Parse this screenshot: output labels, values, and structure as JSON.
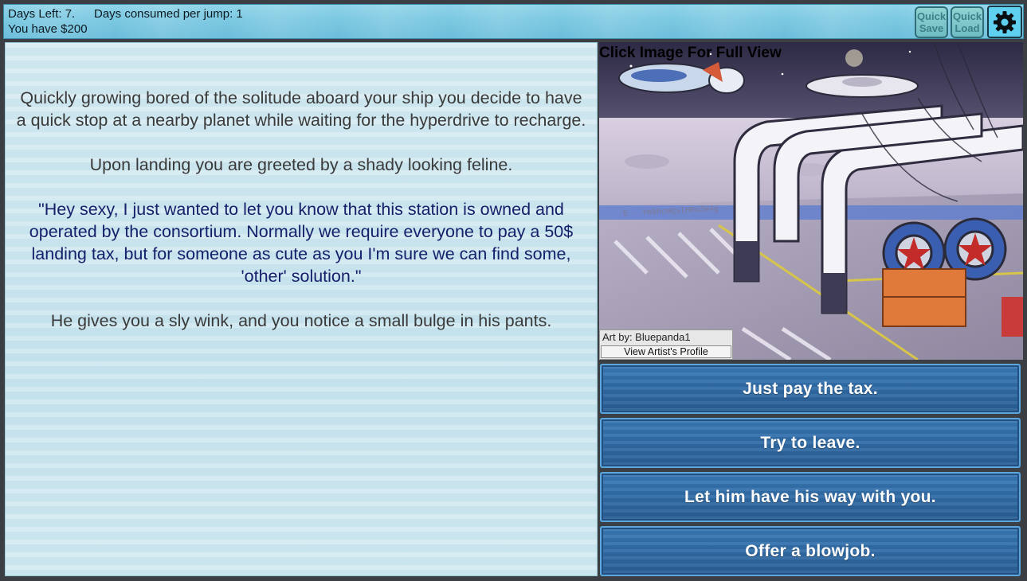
{
  "status": {
    "days_left": "Days Left: 7.",
    "days_per_jump": "Days consumed per jump: 1",
    "money": "You have $200"
  },
  "toolbar": {
    "quick_save": [
      "Quick",
      "Save"
    ],
    "quick_load": [
      "Quick",
      "Load"
    ],
    "settings_icon": "gear-icon"
  },
  "story": {
    "paragraphs": [
      "Quickly growing bored of the solitude aboard your ship you decide to have a quick stop at a nearby planet while waiting for the hyperdrive to recharge.",
      "Upon landing you are greeted by a shady looking feline.",
      "\"Hey sexy, I just wanted to let you know that this station is owned and operated by the consortium. Normally we require everyone to pay a 50$ landing tax, but for someone as cute as you I'm sure we can find some, 'other' solution.\"",
      "He gives you a sly wink, and you notice a small bulge in his pants."
    ]
  },
  "art": {
    "caption": "Click Image For Full View",
    "credit": "Art by: Bluepanda1",
    "profile_button": "View Artist's Profile",
    "watermark": "5 - Ym9hcmQsIHRoZW4g"
  },
  "choices": [
    "Just pay the tax.",
    "Try to leave.",
    "Let him have his way with you.",
    "Offer a blowjob."
  ],
  "colors": {
    "topbar": "#7cc9e2",
    "choice_bg": "#2f6aa4",
    "quote_text": "#16206a",
    "settings_bg": "#5fd0ef"
  }
}
